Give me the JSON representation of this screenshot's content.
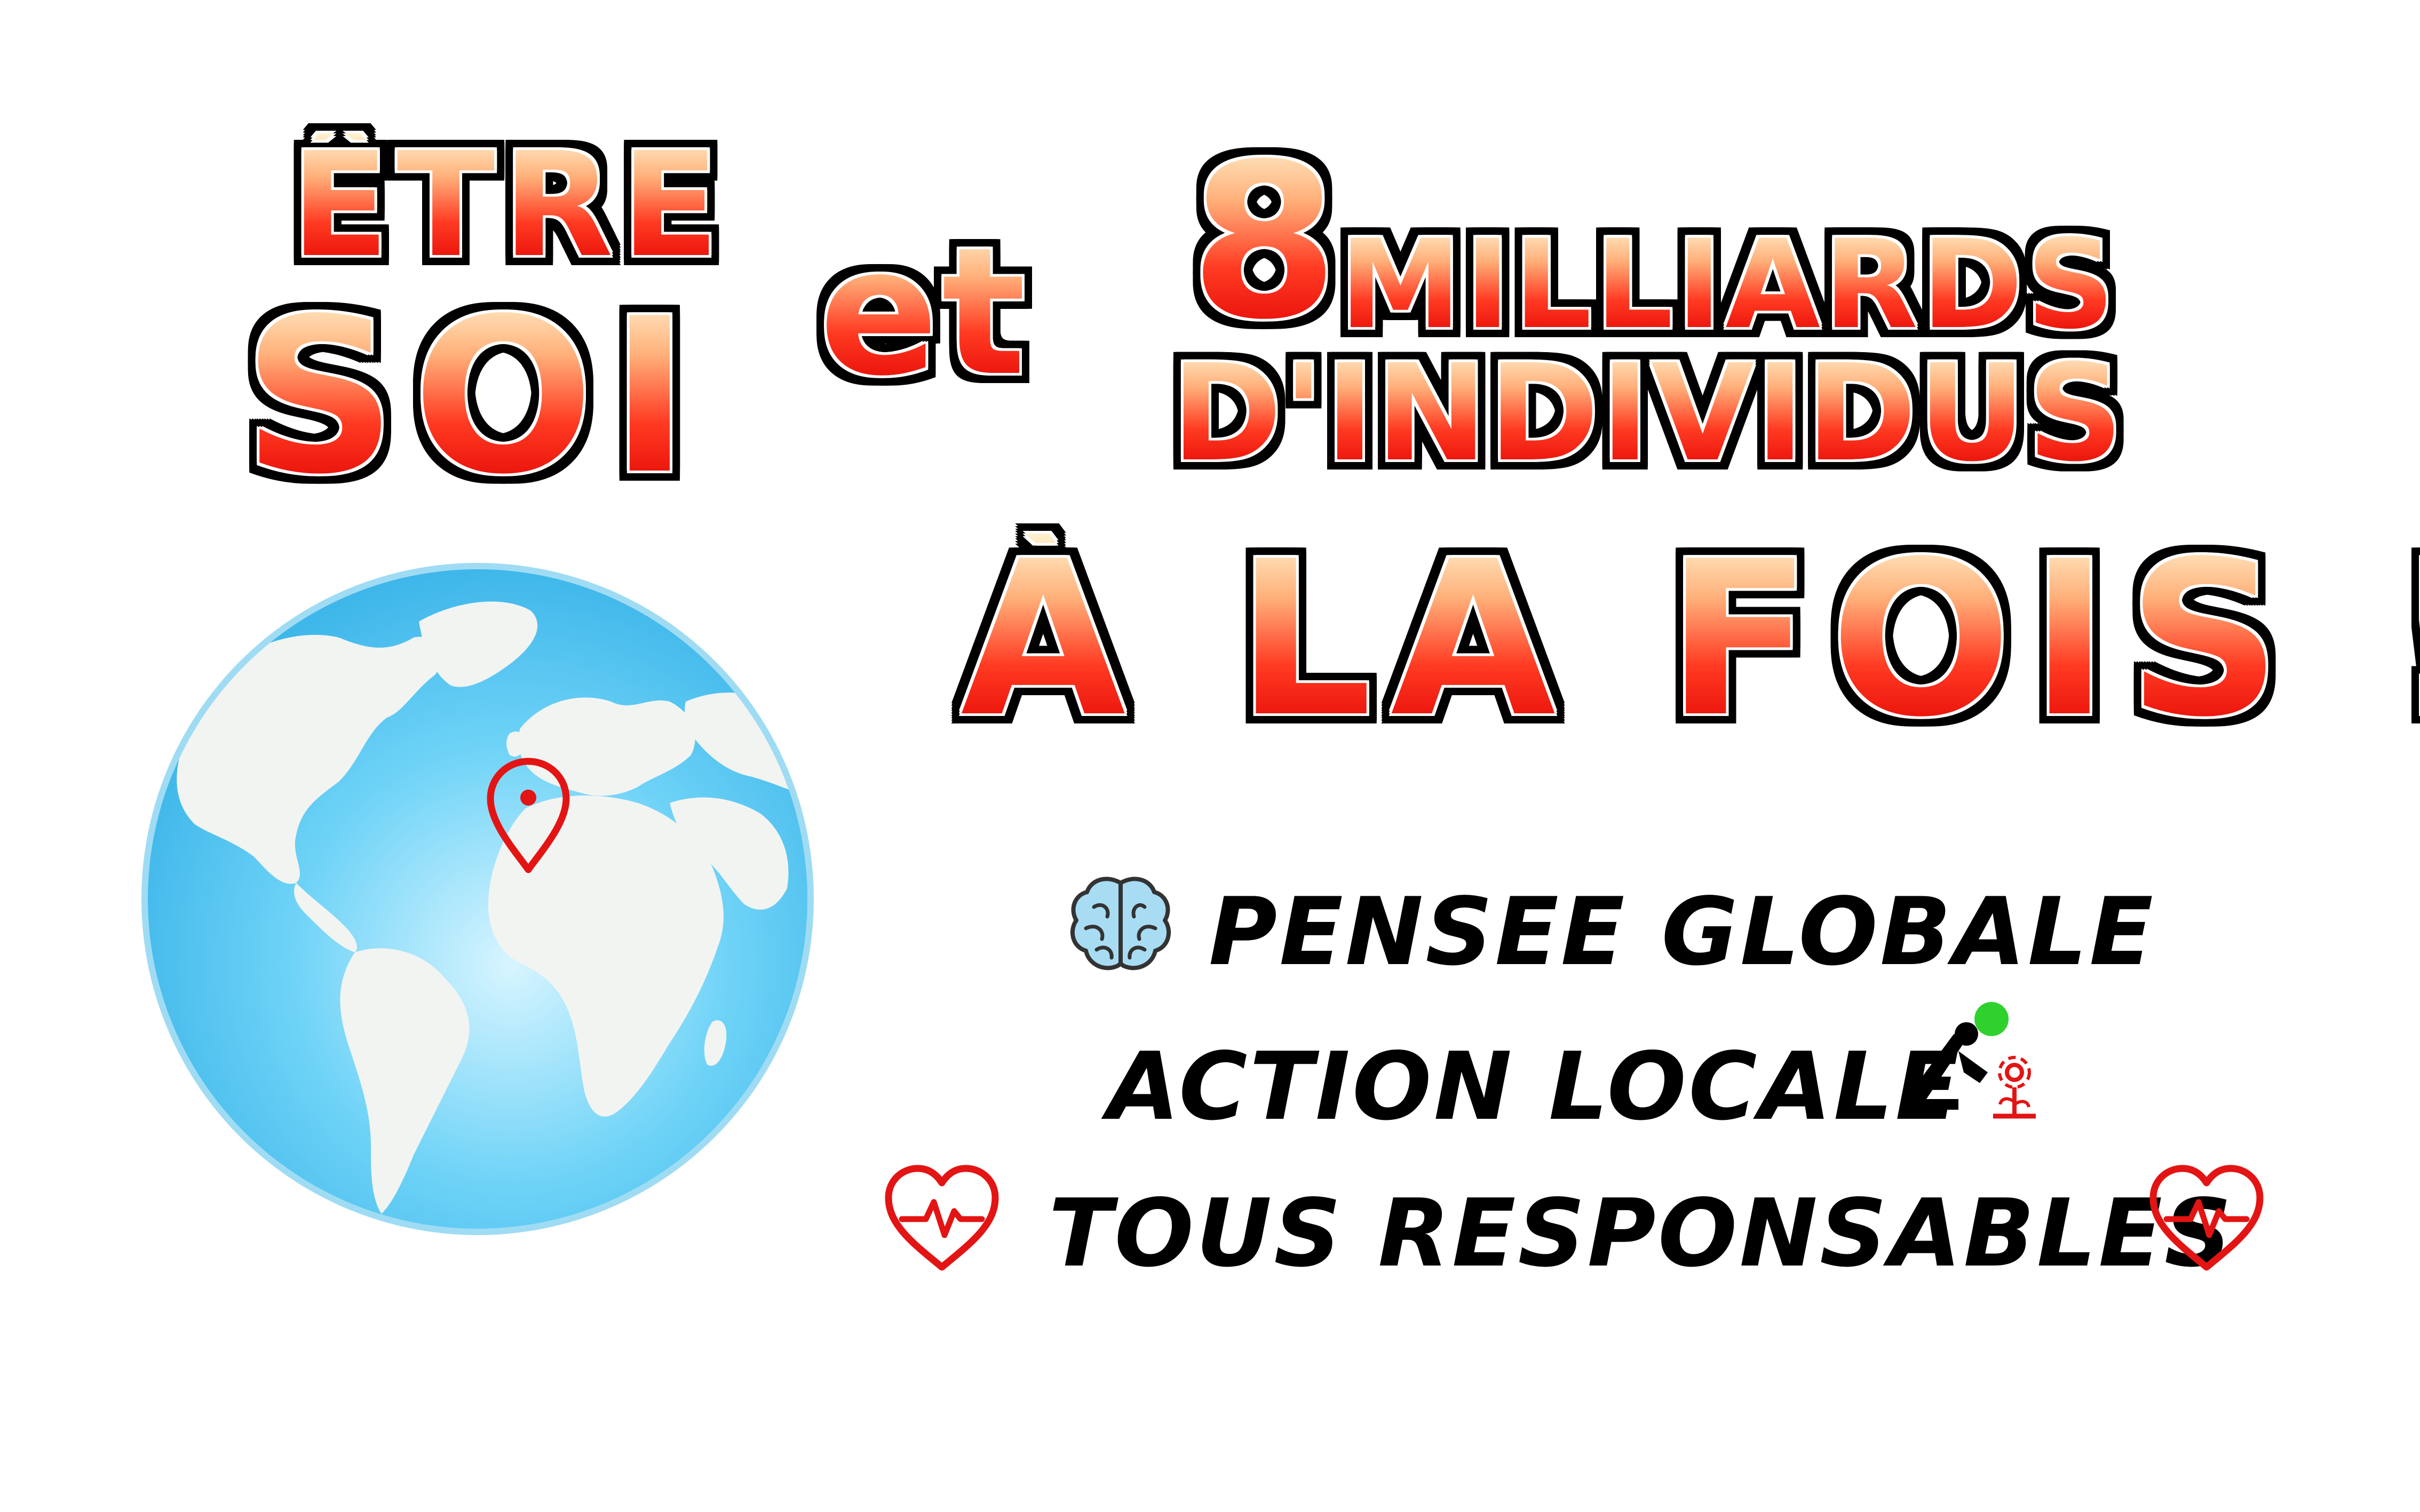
{
  "headline": {
    "etre": "ÊTRE",
    "soi": "SOI",
    "et": "et",
    "eight": "8",
    "milliards": "MILLIARDS",
    "individus": "D'INDIVIDUS",
    "a_la_fois": "À LA FOIS !"
  },
  "slogans": {
    "line1": "PENSEE GLOBALE",
    "line2": "ACTION LOCALE",
    "line3": "TOUS RESPONSABLES"
  },
  "icons": {
    "globe": "globe-icon",
    "pin": "location-pin-icon",
    "brain": "brain-icon",
    "gardener": "person-planting-icon",
    "heart": "heart-pulse-icon"
  },
  "colors": {
    "red": "#e31414",
    "globe_blue": "#4cc6f5",
    "land": "#f2f4f2",
    "brain": "#9fd8f0",
    "green_dot": "#2fd12f"
  }
}
